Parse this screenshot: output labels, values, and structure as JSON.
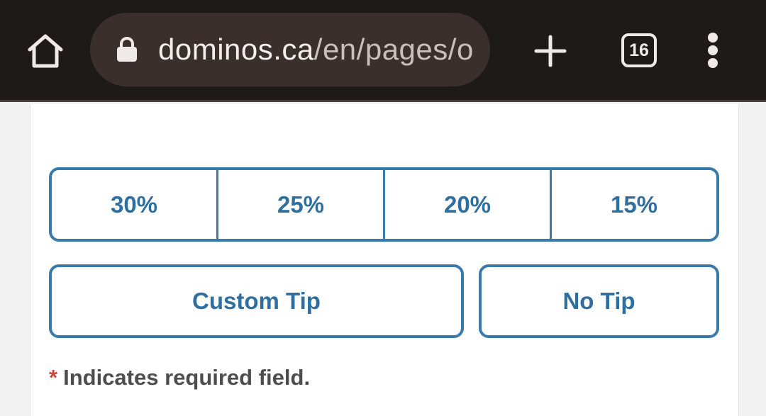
{
  "browser": {
    "url_host": "dominos.ca",
    "url_path": "/en/pages/o",
    "tab_count": "16",
    "icons": {
      "home": "home-icon",
      "lock": "lock-icon",
      "new_tab": "plus-icon",
      "tabs": "tab-switcher-icon",
      "menu": "kebab-menu-icon"
    }
  },
  "tip": {
    "percent_options": [
      "30%",
      "25%",
      "20%",
      "15%"
    ],
    "custom_label": "Custom Tip",
    "no_tip_label": "No Tip"
  },
  "form": {
    "required_asterisk": "*",
    "required_note": "Indicates required field."
  },
  "colors": {
    "browser_bar": "#1f1a1a",
    "url_pill": "#3a2f2c",
    "accent": "#3a7aaa",
    "accent_text": "#2f6f9f",
    "asterisk": "#d0473c"
  }
}
